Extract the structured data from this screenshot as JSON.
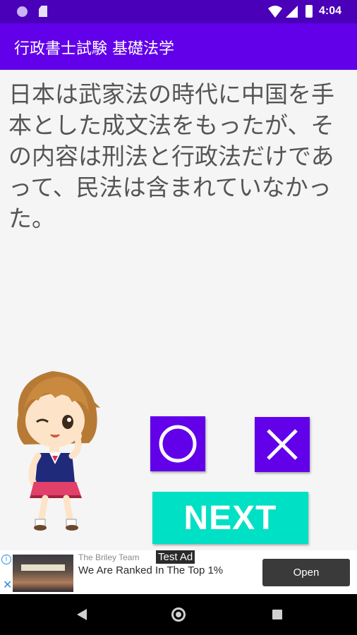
{
  "status_bar": {
    "time": "4:04",
    "icons": [
      "notification-dot-icon",
      "sd-card-icon",
      "wifi-icon",
      "signal-icon",
      "battery-icon"
    ]
  },
  "app_bar": {
    "title": "行政書士試験 基礎法学",
    "color": "#6200ea"
  },
  "question": {
    "text": "日本は武家法の時代に中国を手本とした成文法をもったが、その内容は刑法と行政法だけであって、民法は含まれていなかった。"
  },
  "answers": {
    "maru_icon": "circle-icon",
    "batsu_icon": "cross-icon",
    "button_color": "#6200ea"
  },
  "next_button": {
    "label": "NEXT",
    "color": "#00e0c4"
  },
  "ad": {
    "advertiser": "The Briley Team",
    "badge": "Test Ad",
    "headline": "We Are Ranked In The Top 1%",
    "cta": "Open",
    "icons": [
      "ad-info-icon",
      "ad-close-icon"
    ]
  },
  "nav_bar": {
    "icons": [
      "back-icon",
      "home-icon",
      "recents-icon"
    ]
  }
}
